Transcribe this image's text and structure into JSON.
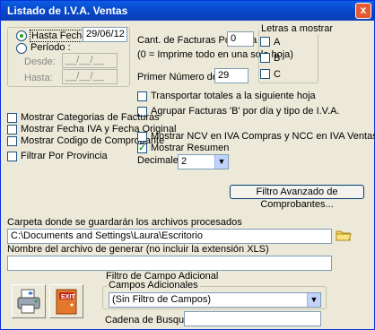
{
  "window": {
    "title": "Listado de I.V.A. Ventas",
    "close": "x"
  },
  "date_group": {
    "hasta_fecha_label": "Hasta Fecha :",
    "hasta_fecha_value": "29/06/12",
    "periodo_label": "Período :",
    "desde_label": "Desde:",
    "desde_value": "__/__/__",
    "hasta_label": "Hasta:",
    "hasta_value": "__/__/__"
  },
  "facturas": {
    "cant_label": "Cant. de Facturas Por Hoja",
    "cant_value": "0",
    "cant_hint": "(0 = Imprime todo en una sola hoja)",
    "primer_label": "Primer Número de Hoja",
    "primer_value": "29"
  },
  "letras": {
    "title": "Letras a mostrar",
    "items": [
      {
        "label": "A"
      },
      {
        "label": "B"
      },
      {
        "label": "C"
      }
    ]
  },
  "options": {
    "transportar": "Transportar totales a la siguiente hoja",
    "agrupar": "Agrupar Facturas 'B' por día y tipo de I.V.A.",
    "mostrar_ncv": "Mostrar NCV en IVA Compras y NCC en IVA Ventas",
    "mostrar_resumen": "Mostrar Resumen"
  },
  "left_options": {
    "categorias": "Mostrar Categorias de Facturas",
    "fecha_iva": "Mostrar Fecha IVA y Fecha Original",
    "codigo": "Mostrar Codigo de Comprobante",
    "provincia": "Filtrar Por Provincia"
  },
  "decimales": {
    "label": "Decimales",
    "value": "2"
  },
  "filtro_avanzado_button": "Filtro Avanzado de Comprobantes...",
  "carpeta": {
    "label": "Carpeta donde se guardarán los archivos procesados",
    "value": "C:\\Documents and Settings\\Laura\\Escritorio"
  },
  "archivo": {
    "label": "Nombre del archivo de generar (no incluir la extensión XLS)",
    "value": ""
  },
  "filtro_campo": {
    "title": "Filtro de Campo Adicional",
    "campos_label": "Campos Adicionales",
    "campos_value": "(Sin Filtro de Campos)",
    "cadena_label": "Cadena de Busqueda",
    "cadena_value": ""
  },
  "exit_label": "EXIT"
}
